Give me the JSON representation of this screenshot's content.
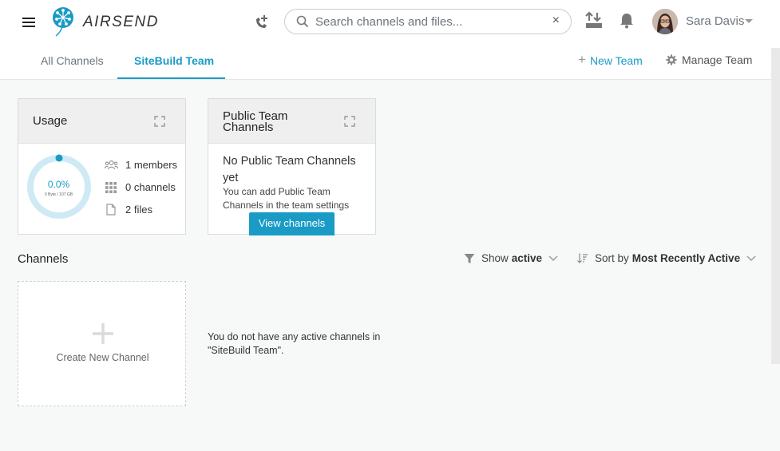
{
  "app": {
    "logo_text": "AIRSEND"
  },
  "header": {
    "search_placeholder": "Search channels and files...",
    "search_clear": "×",
    "user_name": "Sara Davis"
  },
  "tabs": [
    {
      "label": "All Channels",
      "active": false
    },
    {
      "label": "SiteBuild Team",
      "active": true
    }
  ],
  "actions": {
    "new_team_plus": "+",
    "new_team": "New Team",
    "manage_team": "Manage Team"
  },
  "usage": {
    "title": "Usage",
    "percent_text": "0.0%",
    "percent_value": 0.0,
    "storage_text": "0 Byte / 107 GB",
    "members": "1 members",
    "channels": "0 channels",
    "files": "2 files"
  },
  "public_channels": {
    "title": "Public Team Channels",
    "message": "No Public Team Channels yet",
    "sub": "You can add Public Team Channels in the team settings",
    "button": "View channels"
  },
  "channels": {
    "title": "Channels",
    "filter_prefix": "Show",
    "filter_value": "active",
    "sort_prefix": "Sort by",
    "sort_value": "Most Recently Active",
    "create_label": "Create New Channel",
    "empty_message": "You do not have any active channels in \"SiteBuild Team\"."
  },
  "colors": {
    "accent": "#1a9bc6",
    "ring_track": "#cfeaf4"
  }
}
